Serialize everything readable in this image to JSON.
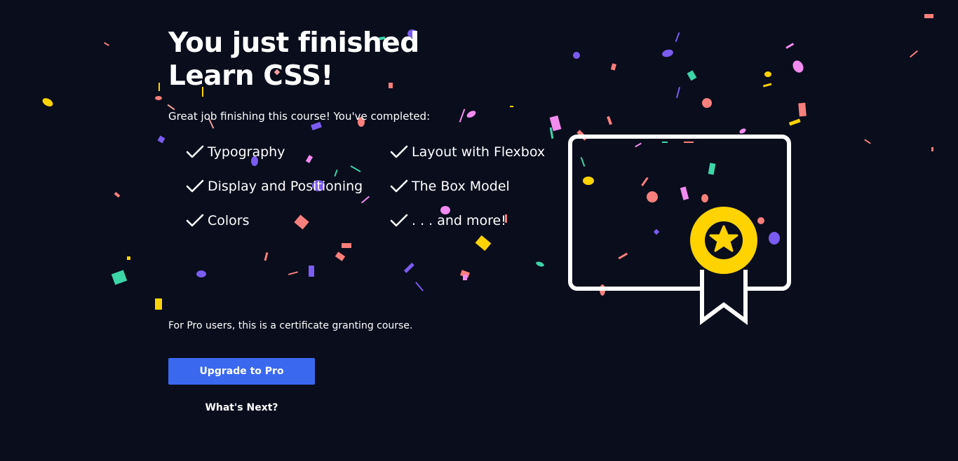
{
  "completion": {
    "title_line1": "You just finished",
    "title_line2": "Learn CSS!",
    "subtitle": "Great job finishing this course! You've completed:",
    "topics": [
      "Typography",
      "Display and Positioning",
      "Colors",
      "Layout with Flexbox",
      "The Box Model",
      ". . . and more!"
    ]
  },
  "pro": {
    "note": "For Pro users, this is a certificate granting course.",
    "upgrade_label": "Upgrade to Pro"
  },
  "next": {
    "label": "What's Next?"
  },
  "icons": {
    "check": "check-icon",
    "certificate": "certificate-icon",
    "star": "star-icon"
  },
  "colors": {
    "background": "#0a0d1c",
    "button": "#3a69f0",
    "badge": "#ffd300",
    "confetti": [
      "#ffd300",
      "#7b5cf0",
      "#f87f7b",
      "#3cd6a8",
      "#f28bf0",
      "#f8a0a0"
    ]
  }
}
